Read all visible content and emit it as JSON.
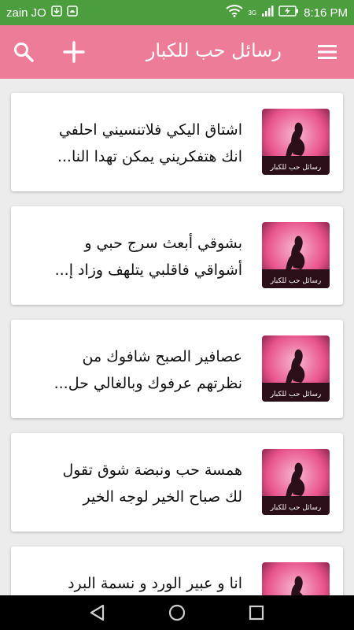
{
  "status_bar": {
    "carrier": "zain JO",
    "network": "3G",
    "time": "8:16 PM",
    "icons": [
      "download-icon",
      "android-icon",
      "wifi-icon",
      "signal-icon",
      "battery-icon"
    ]
  },
  "app_bar": {
    "title": "رسائل حب للكبار",
    "icons": [
      "search-icon",
      "add-icon",
      "menu-icon"
    ]
  },
  "messages": [
    {
      "line1": "اشتاق اليكي فلاتنسيني احلفي",
      "line2": "انك هتفكريني يمكن تهدا النا..."
    },
    {
      "line1": "بشوقي أبعث سرج حبي و",
      "line2": "أشواقي فاقلبي يتلهف وزاد إ..."
    },
    {
      "line1": "عصافير الصبح شافوك من",
      "line2": "نظرتهم عرفوك وبالغالي حل..."
    },
    {
      "line1": "همسة حب ونبضة شوق تقول",
      "line2": "لك صباح الخير لوجه الخير"
    },
    {
      "line1": "انا و عبير الورد و نسمة البرد",
      "line2": ""
    }
  ],
  "thumbnail": {
    "caption": "رسائل حب للكبار"
  },
  "colors": {
    "status_bar": "#4b9d3e",
    "app_bar": "#ed7c99",
    "background": "#ececec",
    "thumb_pink": "#e8548c",
    "nav_bar": "#000000"
  },
  "nav_bar": {
    "icons": [
      "back-icon",
      "home-icon",
      "recents-icon"
    ]
  }
}
